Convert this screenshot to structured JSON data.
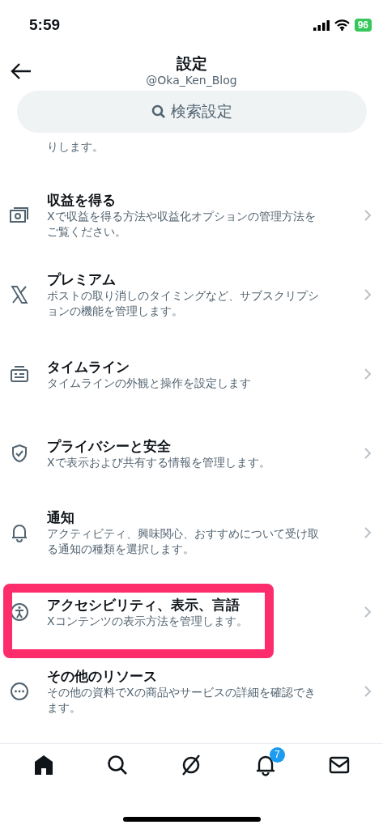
{
  "status_bar": {
    "time": "5:59",
    "battery": "96"
  },
  "header": {
    "title": "設定",
    "handle": "@Oka_Ken_Blog"
  },
  "search": {
    "placeholder": "検索設定"
  },
  "partial_text": "りします。",
  "items": [
    {
      "kind": "money",
      "title": "収益を得る",
      "description": "Xで収益を得る方法や収益化オプションの管理方法をご覧ください。",
      "highlighted": false
    },
    {
      "kind": "premium",
      "title": "プレミアム",
      "description": "ポストの取り消しのタイミングなど、サブスクリプションの機能を管理します。",
      "highlighted": false
    },
    {
      "kind": "timeline",
      "title": "タイムライン",
      "description": "タイムラインの外観と操作を設定します",
      "highlighted": false
    },
    {
      "kind": "privacy",
      "title": "プライバシーと安全",
      "description": "Xで表示および共有する情報を管理します。",
      "highlighted": false
    },
    {
      "kind": "notifications",
      "title": "通知",
      "description": "アクティビティ、興味関心、おすすめについて受け取る通知の種類を選択します。",
      "highlighted": false
    },
    {
      "kind": "accessibility",
      "title": "アクセシビリティ、表示、言語",
      "description": "Xコンテンツの表示方法を管理します。",
      "highlighted": true
    },
    {
      "kind": "resources",
      "title": "その他のリソース",
      "description": "その他の資料でXの商品やサービスの詳細を確認できます。",
      "highlighted": false
    }
  ],
  "tab_bar": [
    {
      "kind": "home",
      "selected": true
    },
    {
      "kind": "search",
      "selected": false
    },
    {
      "kind": "grok",
      "selected": false
    },
    {
      "kind": "notifications",
      "selected": false,
      "badge": "7"
    },
    {
      "kind": "messages",
      "selected": false
    }
  ]
}
